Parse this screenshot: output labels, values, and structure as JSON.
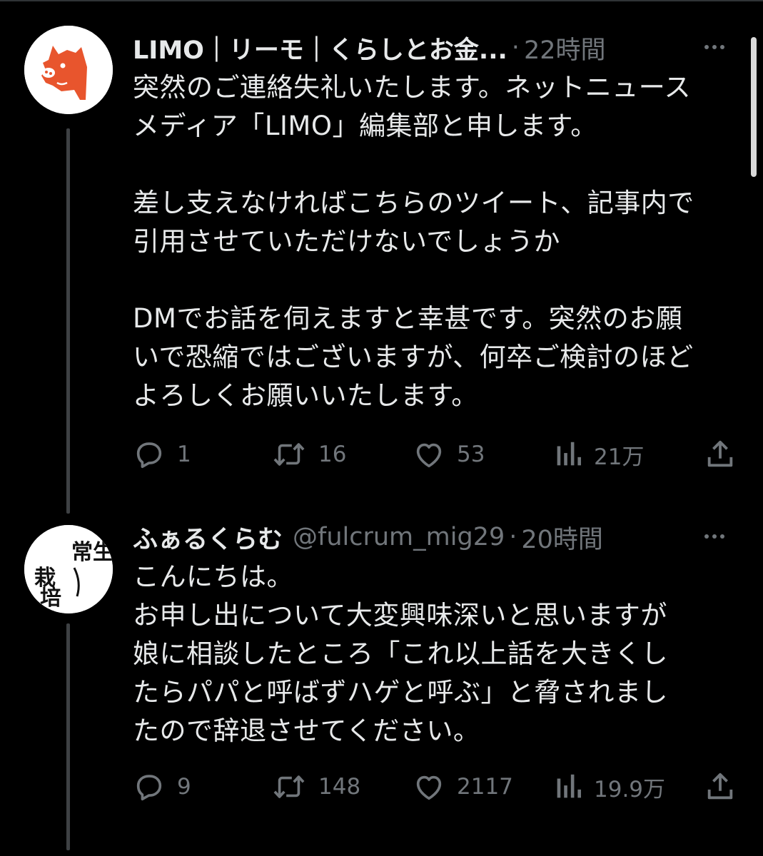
{
  "tweets": [
    {
      "display_name": "LIMO｜リーモ｜くらしとお金...",
      "handle": "",
      "separator": "·",
      "time": "22時間",
      "body_lines": [
        "突然のご連絡失礼いたします。ネットニュース",
        "メディア「LIMO」編集部と申します。",
        "",
        "差し支えなければこちらのツイート、記事内で",
        "引用させていただけないでしょうか",
        "",
        "DMでお話を伺えますと幸甚です。突然のお願",
        "いで恐縮ではございますが、何卒ご検討のほど",
        "よろしくお願いいたします。"
      ],
      "replies": "1",
      "retweets": "16",
      "likes": "53",
      "views": "21万",
      "avatar_icon": "pig-logo-icon",
      "avatar_color": "#e8552d"
    },
    {
      "display_name": "ふぁるくらむ",
      "handle": "@fulcrum_mig29",
      "separator": "·",
      "time": "20時間",
      "body_lines": [
        "こんにちは。",
        "お申し出について大変興味深いと思いますが",
        "娘に相談したところ「これ以上話を大きくし",
        "たらパパと呼ばずハゲと呼ぶ」と脅されまし",
        "たので辞退させてください。"
      ],
      "replies": "9",
      "retweets": "148",
      "likes": "2117",
      "views": "19.9万",
      "avatar_icon": "calligraphy-icon",
      "avatar_calligraphy": "常生栽培"
    }
  ],
  "colors": {
    "background": "#000000",
    "text_primary": "#e7e9ea",
    "text_secondary": "#71767b",
    "thread_line": "#3e4144"
  }
}
